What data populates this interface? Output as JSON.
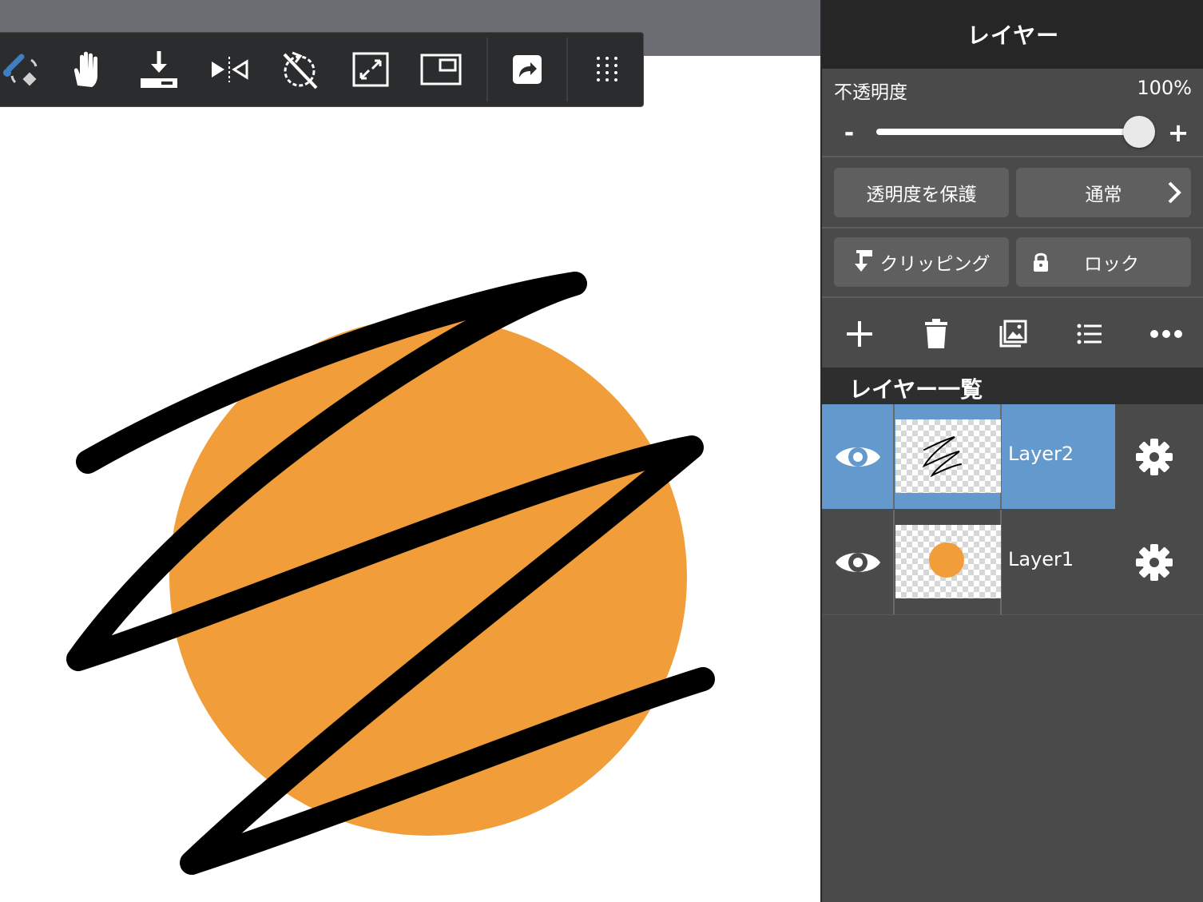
{
  "toolbar": {
    "tools": [
      {
        "icon": "transform-brush-icon"
      },
      {
        "icon": "hand-icon"
      },
      {
        "icon": "download-tray-icon"
      },
      {
        "icon": "flip-horizontal-icon"
      },
      {
        "icon": "rotate-reset-icon"
      },
      {
        "icon": "fullscreen-icon"
      },
      {
        "icon": "window-icon"
      },
      {
        "icon": "share-icon"
      },
      {
        "icon": "grid-dots-icon"
      }
    ]
  },
  "canvas": {
    "background": "#ffffff",
    "circle_color": "#f09d3a",
    "stroke_color": "#000000"
  },
  "panel": {
    "title": "レイヤー",
    "opacity": {
      "label": "不透明度",
      "value_text": "100%",
      "value": 1.0,
      "minus_label": "-",
      "plus_label": "+"
    },
    "protect_alpha_label": "透明度を保護",
    "blend_mode_label": "通常",
    "clipping_label": "クリッピング",
    "lock_label": "ロック",
    "actions": [
      "plus-icon",
      "trash-icon",
      "image-layer-icon",
      "list-icon",
      "more-icon"
    ],
    "layer_list_title": "レイヤー一覧",
    "layers": [
      {
        "name": "Layer2",
        "selected": true,
        "visible": true,
        "thumbnail": "scribble"
      },
      {
        "name": "Layer1",
        "selected": false,
        "visible": true,
        "thumbnail": "orange-circle"
      }
    ]
  },
  "colors": {
    "selected_layer": "#6499ce",
    "panel_bg": "#4a4a4a",
    "header_bg": "#262626",
    "button_bg": "#5f5f5f",
    "toolbar_bg": "#2b2c2e",
    "accent_blue": "#3d7fc0"
  }
}
